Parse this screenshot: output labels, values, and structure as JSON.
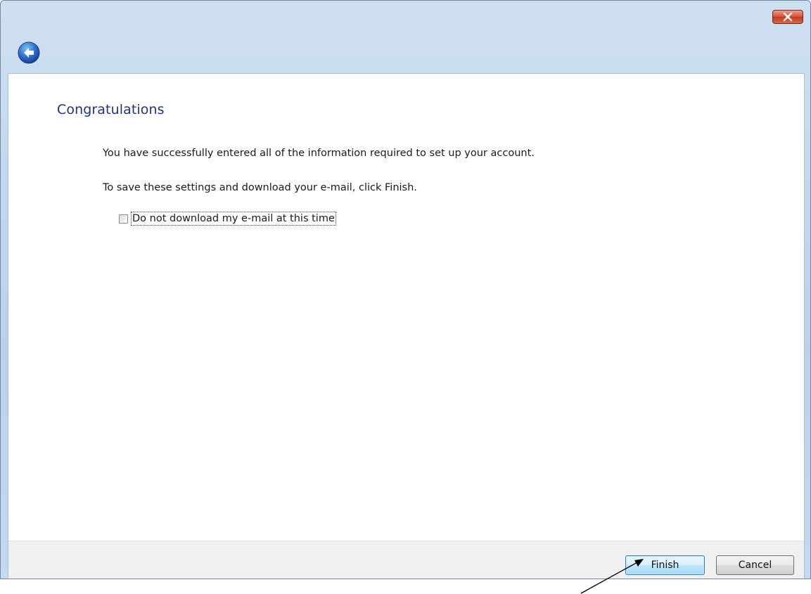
{
  "window": {
    "icons": {
      "back": "back-arrow-icon",
      "close": "close-icon"
    },
    "colors": {
      "title": "#1e3287",
      "close_button": "#c23a21",
      "frame": "#b9d1ea"
    }
  },
  "content": {
    "title": "Congratulations",
    "message_1": "You have successfully entered all of the information required to set up your account.",
    "message_2": "To save these settings and download your e-mail, click Finish.",
    "checkbox": {
      "label": "Do not download my e-mail at this time",
      "checked": false
    }
  },
  "footer": {
    "finish_label": "Finish",
    "cancel_label": "Cancel"
  }
}
